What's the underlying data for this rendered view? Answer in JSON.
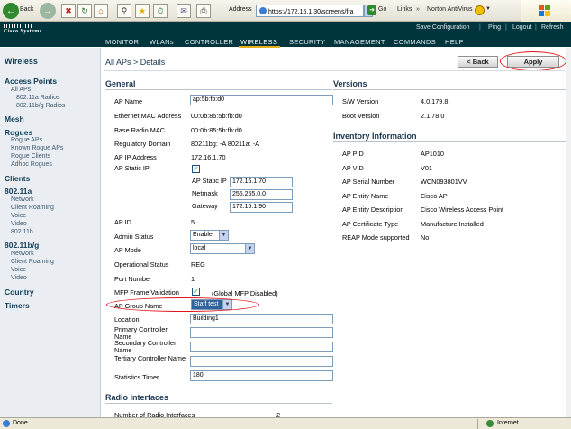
{
  "toolbar": {
    "back_label": "Back",
    "address_label": "Address",
    "address_url": "https://172.16.1.30/screens/fra",
    "go_label": "Go",
    "links_label": "Links",
    "norton_label": "Norton AntiVirus"
  },
  "header": {
    "brand": "Cisco Systems",
    "top_links": [
      "Save Configuration",
      "Ping",
      "Logout",
      "Refresh"
    ],
    "nav": [
      "MONITOR",
      "WLANs",
      "CONTROLLER",
      "WIRELESS",
      "SECURITY",
      "MANAGEMENT",
      "COMMANDS",
      "HELP"
    ],
    "active_nav": "WIRELESS"
  },
  "sidebar": {
    "title": "Wireless",
    "sections": [
      {
        "label": "Access Points",
        "items": [
          "All APs",
          "802.11a Radios",
          "802.11b/g Radios"
        ]
      },
      {
        "label": "Mesh",
        "items": []
      },
      {
        "label": "Rogues",
        "items": [
          "Rogue APs",
          "Known Rogue APs",
          "Rogue Clients",
          "Adhoc Rogues"
        ]
      },
      {
        "label": "Clients",
        "items": []
      },
      {
        "label": "802.11a",
        "items": [
          "Network",
          "Client Roaming",
          "Voice",
          "Video",
          "802.11h"
        ]
      },
      {
        "label": "802.11b/g",
        "items": [
          "Network",
          "Client Roaming",
          "Voice",
          "Video"
        ]
      },
      {
        "label": "Country",
        "items": []
      },
      {
        "label": "Timers",
        "items": []
      }
    ]
  },
  "page": {
    "breadcrumb": "All APs > Details",
    "back_button": "< Back",
    "apply_button": "Apply"
  },
  "general": {
    "title": "General",
    "ap_name_label": "AP Name",
    "ap_name_value": "ap:5b:fb:d0",
    "eth_mac_label": "Ethernet MAC Address",
    "eth_mac_value": "00:0b:85:5b:fb:d0",
    "base_mac_label": "Base Radio MAC",
    "base_mac_value": "00:0b:85:5b:fb:d0",
    "reg_domain_label": "Regulatory Domain",
    "reg_domain_value": "80211bg: -A 80211a: -A",
    "ap_ip_label": "AP IP Address",
    "ap_ip_value": "172.16.1.70",
    "static_ip_label": "AP Static IP",
    "static_ip_checked": true,
    "static_ip_sub_label": "AP Static IP",
    "static_ip_value": "172.16.1.70",
    "netmask_label": "Netmask",
    "netmask_value": "255.255.0.0",
    "gateway_label": "Gateway",
    "gateway_value": "172.16.1.90",
    "ap_id_label": "AP ID",
    "ap_id_value": "5",
    "admin_status_label": "Admin Status",
    "admin_status_value": "Enable",
    "ap_mode_label": "AP Mode",
    "ap_mode_value": "local",
    "op_status_label": "Operational Status",
    "op_status_value": "REG",
    "port_label": "Port Number",
    "port_value": "1",
    "mfp_label": "MFP Frame Validation",
    "mfp_checked": true,
    "mfp_note": "(Global MFP Disabled)",
    "group_label": "AP Group Name",
    "group_value": "Staff test",
    "location_label": "Location",
    "location_value": "Building1",
    "primary_label": "Primary Controller Name",
    "primary_value": "",
    "secondary_label": "Secondary Controller Name",
    "secondary_value": "",
    "tertiary_label": "Tertiary Controller Name",
    "tertiary_value": "",
    "timer_label": "Statistics Timer",
    "timer_value": "180"
  },
  "radio": {
    "title": "Radio Interfaces",
    "count_label": "Number of Radio Interfaces",
    "count_value": "2"
  },
  "versions": {
    "title": "Versions",
    "sw_label": "S/W Version",
    "sw_value": "4.0.179.8",
    "boot_label": "Boot Version",
    "boot_value": "2.1.78.0"
  },
  "inventory": {
    "title": "Inventory Information",
    "pid_label": "AP PID",
    "pid_value": "AP1010",
    "vid_label": "AP VID",
    "vid_value": "V01",
    "serial_label": "AP Serial Number",
    "serial_value": "WCN093801VV",
    "entity_label": "AP Entity Name",
    "entity_value": "Cisco AP",
    "desc_label": "AP Entity Description",
    "desc_value": "Cisco Wireless Access Point",
    "cert_label": "AP Certificate Type",
    "cert_value": "Manufacture Installed",
    "reap_label": "REAP Mode supported",
    "reap_value": "No"
  },
  "statusbar": {
    "left": "Done",
    "zone": "Internet"
  },
  "colors": {
    "header_bg": "#00353e",
    "active_underline": "#e8b018",
    "annotation_red": "#e0151b"
  }
}
